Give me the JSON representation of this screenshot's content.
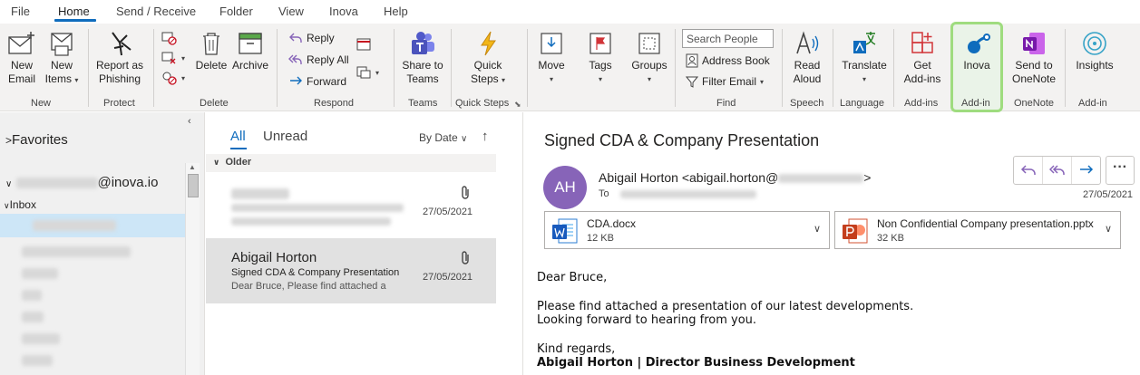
{
  "menu": {
    "tabs": [
      "File",
      "Home",
      "Send / Receive",
      "Folder",
      "View",
      "Inova",
      "Help"
    ],
    "active": "Home"
  },
  "ribbon": {
    "new_email": [
      "New",
      "Email"
    ],
    "new_items": [
      "New",
      "Items"
    ],
    "report_phishing": [
      "Report as",
      "Phishing"
    ],
    "delete": "Delete",
    "archive": "Archive",
    "reply": "Reply",
    "reply_all": "Reply All",
    "forward": "Forward",
    "share_teams": [
      "Share to",
      "Teams"
    ],
    "quick_steps": [
      "Quick",
      "Steps"
    ],
    "move": "Move",
    "tags": "Tags",
    "groups": "Groups",
    "search_people": "Search People",
    "address_book": "Address Book",
    "filter_email": "Filter Email",
    "read_aloud": [
      "Read",
      "Aloud"
    ],
    "translate": "Translate",
    "get_addins": [
      "Get",
      "Add-ins"
    ],
    "inova": "Inova",
    "send_onenote": [
      "Send to",
      "OneNote"
    ],
    "insights": "Insights",
    "groups_labels": {
      "new": "New",
      "protect": "Protect",
      "delete": "Delete",
      "respond": "Respond",
      "teams": "Teams",
      "quick_steps": "Quick Steps",
      "find": "Find",
      "speech": "Speech",
      "language": "Language",
      "addins": "Add-ins",
      "addin": "Add-in",
      "onenote": "OneNote",
      "addin2": "Add-in"
    },
    "colors": {
      "highlight": "#9fdc7f",
      "accent": "#0f6cbd"
    }
  },
  "folders": {
    "favorites": "Favorites",
    "account_suffix": "@inova.io",
    "inbox": "Inbox"
  },
  "list": {
    "tab_all": "All",
    "tab_unread": "Unread",
    "sort": "By Date",
    "group": "Older",
    "messages": [
      {
        "date": "27/05/2021"
      },
      {
        "from": "Abigail Horton",
        "subject": "Signed CDA & Company Presentation",
        "preview": "Dear Bruce,  Please find attached a",
        "date": "27/05/2021"
      }
    ]
  },
  "reading": {
    "subject": "Signed CDA & Company Presentation",
    "avatar": "AH",
    "sender_prefix": "Abigail Horton <abigail.horton@",
    "sender_suffix": ">",
    "to_label": "To",
    "date": "27/05/2021",
    "attachments": [
      {
        "name": "CDA.docx",
        "size": "12 KB",
        "type": "word"
      },
      {
        "name": "Non Confidential Company presentation.pptx",
        "size": "32 KB",
        "type": "powerpoint"
      }
    ],
    "body": {
      "greeting": "Dear Bruce,",
      "line1": "Please find attached a presentation of our latest developments.",
      "line2": "Looking forward to hearing from you.",
      "closing": "Kind regards,",
      "signature": "Abigail Horton | Director Business Development"
    }
  }
}
